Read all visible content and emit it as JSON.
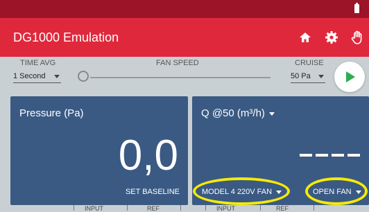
{
  "app": {
    "title": "DG1000 Emulation"
  },
  "controls": {
    "time_avg_label": "TIME AVG",
    "time_avg_value": "1 Second",
    "fan_speed_label": "FAN SPEED",
    "cruise_label": "CRUISE",
    "cruise_value": "50 Pa"
  },
  "pressure_panel": {
    "title": "Pressure (Pa)",
    "value": "0,0",
    "set_baseline_label": "SET BASELINE"
  },
  "flow_panel": {
    "title": "Q @50 (m³/h)",
    "fan_model_label": "MODEL 4 220V FAN",
    "fan_config_label": "OPEN FAN"
  },
  "bottom_tabs": [
    "INPUT",
    "REF",
    "INPUT",
    "REF"
  ],
  "icons": [
    "battery-icon",
    "home-icon",
    "gear-icon",
    "hand-icon",
    "play-icon",
    "caret-down-icon"
  ],
  "colors": {
    "statusbar": "#9b1428",
    "appbar": "#e0283c",
    "panel": "#3a5a83",
    "highlight": "#f5ea07",
    "play": "#2eac52"
  }
}
